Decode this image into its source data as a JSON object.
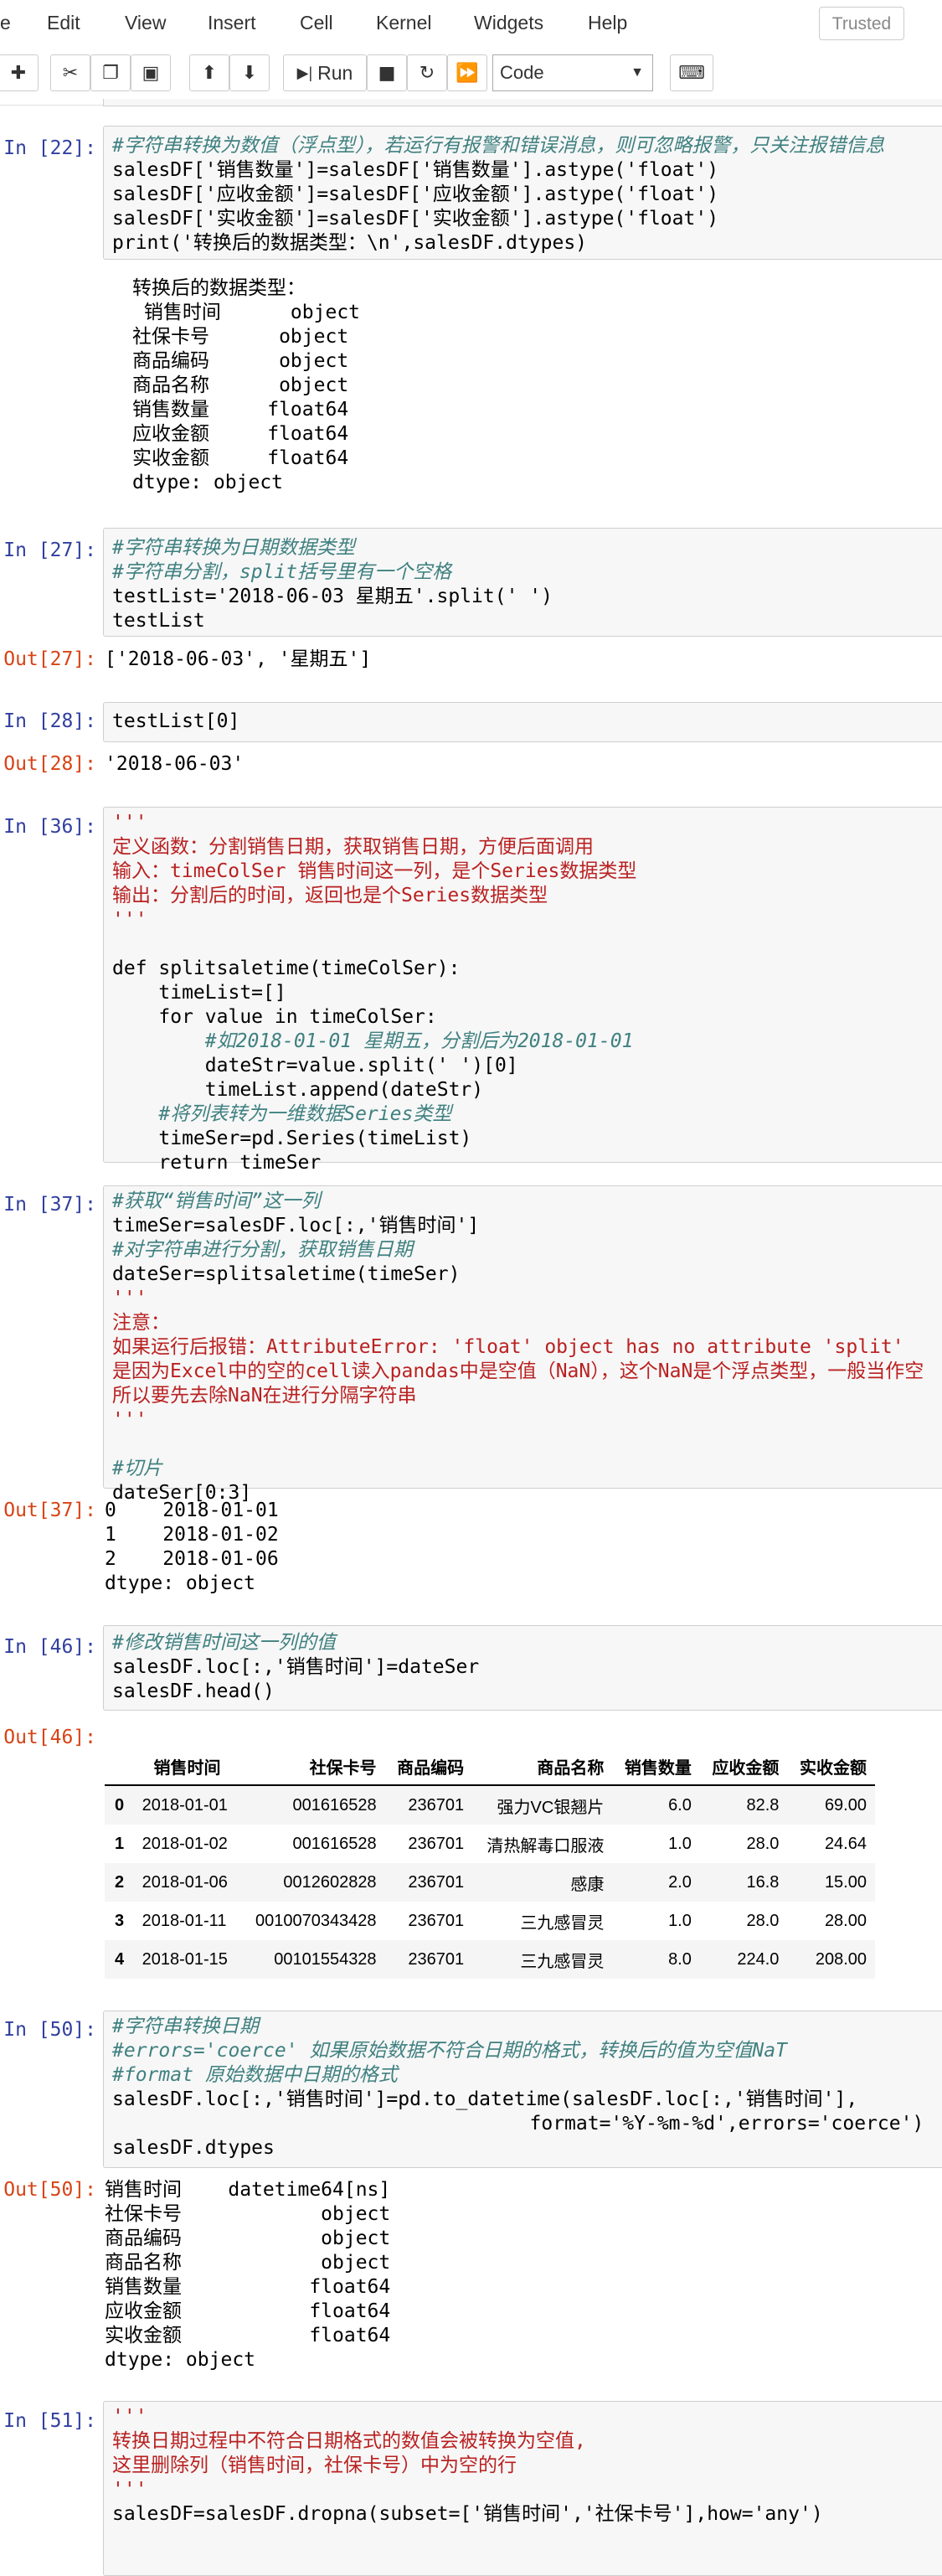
{
  "menu": {
    "partial": "e",
    "edit": "Edit",
    "view": "View",
    "insert": "Insert",
    "cell": "Cell",
    "kernel": "Kernel",
    "widgets": "Widgets",
    "help": "Help",
    "trusted": "Trusted"
  },
  "toolbar": {
    "run": "Run",
    "cell_type": "Code"
  },
  "cells": {
    "c22": {
      "prompt": "In [22]:",
      "l1": "#字符串转换为数值（浮点型），若运行有报警和错误消息，则可忽略报警，只关注报错信息",
      "l2": "salesDF['销售数量']=salesDF['销售数量'].astype('float')",
      "l3": "salesDF['应收金额']=salesDF['应收金额'].astype('float')",
      "l4": "salesDF['实收金额']=salesDF['实收金额'].astype('float')",
      "l5": "print('转换后的数据类型：\\n',salesDF.dtypes)",
      "output": "转换后的数据类型：\n 销售时间      object\n社保卡号      object\n商品编码      object\n商品名称      object\n销售数量     float64\n应收金额     float64\n实收金额     float64\ndtype: object"
    },
    "c27": {
      "prompt": "In [27]:",
      "l1": "#字符串转换为日期数据类型",
      "l2": "#字符串分割，split括号里有一个空格",
      "l3": "testList='2018-06-03 星期五'.split(' ')",
      "l4": "testList",
      "out_prompt": "Out[27]:",
      "output": "['2018-06-03', '星期五']"
    },
    "c28": {
      "prompt": "In [28]:",
      "l1": "testList[0]",
      "out_prompt": "Out[28]:",
      "output": "'2018-06-03'"
    },
    "c36": {
      "prompt": "In [36]:",
      "l1": "'''",
      "l2": "定义函数：分割销售日期，获取销售日期，方便后面调用",
      "l3": "输入：timeColSer 销售时间这一列，是个Series数据类型",
      "l4": "输出：分割后的时间，返回也是个Series数据类型",
      "l5": "'''",
      "l7": "def splitsaletime(timeColSer):",
      "l8": "    timeList=[]",
      "l9": "    for value in timeColSer:",
      "l10": "        #如2018-01-01 星期五，分割后为2018-01-01",
      "l11": "        dateStr=value.split(' ')[0]",
      "l12": "        timeList.append(dateStr)",
      "l13": "    #将列表转为一维数据Series类型",
      "l14": "    timeSer=pd.Series(timeList)",
      "l15": "    return timeSer"
    },
    "c37": {
      "prompt": "In [37]:",
      "l1": "#获取“销售时间”这一列",
      "l2": "timeSer=salesDF.loc[:,'销售时间']",
      "l3": "#对字符串进行分割，获取销售日期",
      "l4": "dateSer=splitsaletime(timeSer)",
      "l5": "'''",
      "l6": "注意：",
      "l7": "如果运行后报错：AttributeError: 'float' object has no attribute 'split'",
      "l8": "是因为Excel中的空的cell读入pandas中是空值（NaN），这个NaN是个浮点类型，一般当作空",
      "l9": "所以要先去除NaN在进行分隔字符串",
      "l10": "'''",
      "l11": "#切片",
      "l12": "dateSer[0:3]",
      "out_prompt": "Out[37]:",
      "output": "0    2018-01-01\n1    2018-01-02\n2    2018-01-06\ndtype: object"
    },
    "c46": {
      "prompt": "In [46]:",
      "l1": "#修改销售时间这一列的值",
      "l2": "salesDF.loc[:,'销售时间']=dateSer",
      "l3": "salesDF.head()",
      "out_prompt": "Out[46]:",
      "table": {
        "columns": [
          "",
          "销售时间",
          "社保卡号",
          "商品编码",
          "商品名称",
          "销售数量",
          "应收金额",
          "实收金额"
        ],
        "rows": [
          [
            "0",
            "2018-01-01",
            "001616528",
            "236701",
            "强力VC银翘片",
            "6.0",
            "82.8",
            "69.00"
          ],
          [
            "1",
            "2018-01-02",
            "001616528",
            "236701",
            "清热解毒口服液",
            "1.0",
            "28.0",
            "24.64"
          ],
          [
            "2",
            "2018-01-06",
            "0012602828",
            "236701",
            "感康",
            "2.0",
            "16.8",
            "15.00"
          ],
          [
            "3",
            "2018-01-11",
            "0010070343428",
            "236701",
            "三九感冒灵",
            "1.0",
            "28.0",
            "28.00"
          ],
          [
            "4",
            "2018-01-15",
            "00101554328",
            "236701",
            "三九感冒灵",
            "8.0",
            "224.0",
            "208.00"
          ]
        ]
      }
    },
    "c50": {
      "prompt": "In [50]:",
      "l1": "#字符串转换日期",
      "l2": "#errors='coerce' 如果原始数据不符合日期的格式，转换后的值为空值NaT",
      "l3": "#format 原始数据中日期的格式",
      "l4": "salesDF.loc[:,'销售时间']=pd.to_datetime(salesDF.loc[:,'销售时间'],",
      "l5": "                                    format='%Y-%m-%d',errors='coerce')",
      "l6": "salesDF.dtypes",
      "out_prompt": "Out[50]:",
      "output": "销售时间    datetime64[ns]\n社保卡号            object\n商品编码            object\n商品名称            object\n销售数量           float64\n应收金额           float64\n实收金额           float64\ndtype: object"
    },
    "c51": {
      "prompt": "In [51]:",
      "l1": "'''",
      "l2": "转换日期过程中不符合日期格式的数值会被转换为空值,",
      "l3": "这里删除列（销售时间，社保卡号）中为空的行",
      "l4": "'''",
      "l5": "salesDF=salesDF.dropna(subset=['销售时间','社保卡号'],how='any')"
    }
  }
}
